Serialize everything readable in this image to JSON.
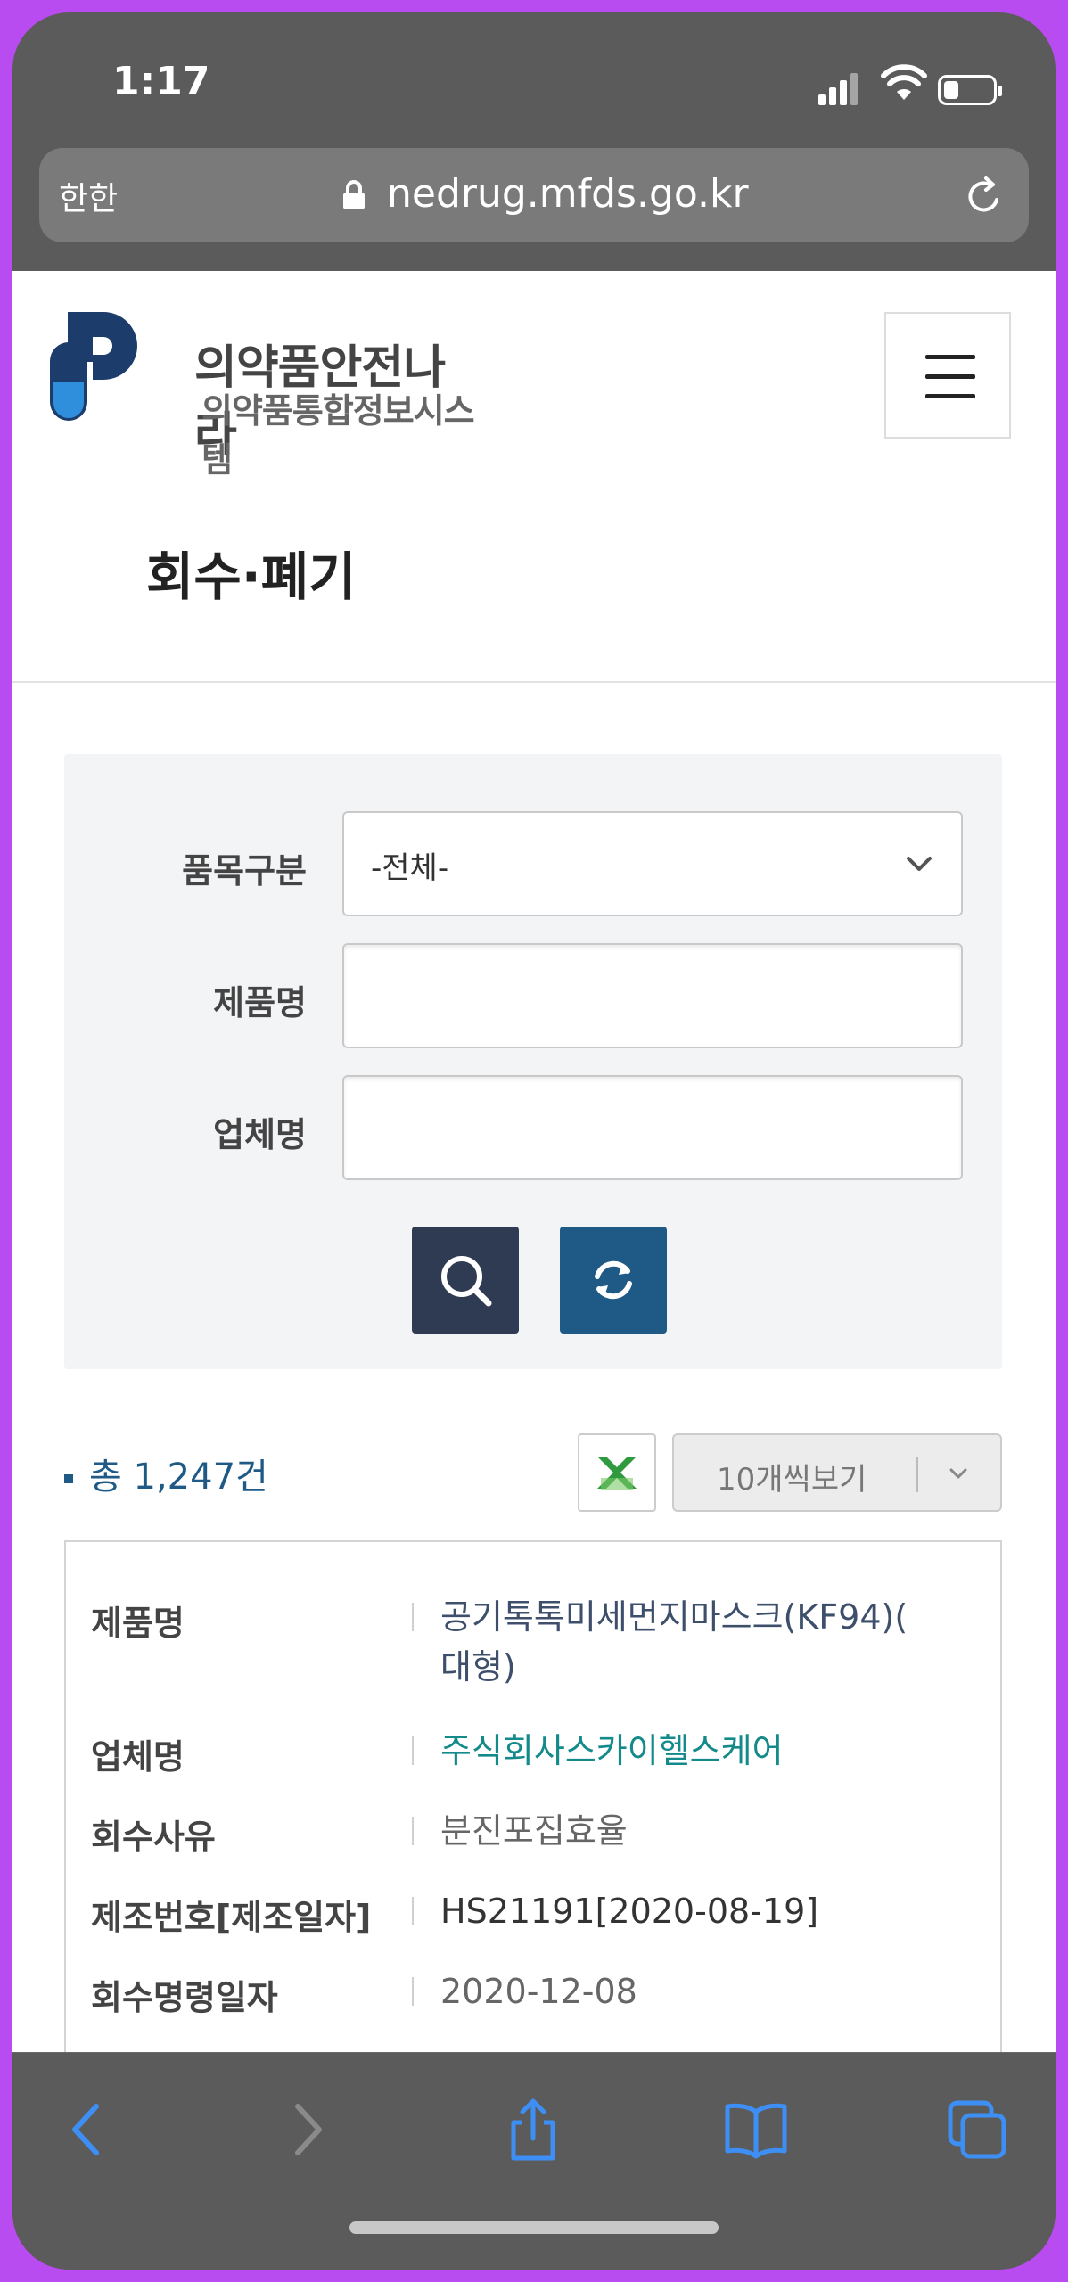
{
  "status_bar": {
    "time": "1:17"
  },
  "browser": {
    "aa_label": "한한",
    "url": "nedrug.mfds.go.kr"
  },
  "site": {
    "logo_title": "의약품안전나라",
    "logo_subtitle": "의약품통합정보시스템"
  },
  "page_title": "회수·폐기",
  "search": {
    "category_label": "품목구분",
    "category_value": "-전체-",
    "product_label": "제품명",
    "company_label": "업체명"
  },
  "results": {
    "total_text": "총 1,247건",
    "per_page": "10개씩보기"
  },
  "record": {
    "fields": [
      {
        "key": "제품명",
        "value": "공기톡톡미세먼지마스크(KF94)(\n대형)"
      },
      {
        "key": "업체명",
        "value": "주식회사스카이헬스케어"
      },
      {
        "key": "회수사유",
        "value": "분진포집효율"
      },
      {
        "key": "제조번호[제조일자]",
        "value": "HS21191[2020-08-19]"
      },
      {
        "key": "회수명령일자",
        "value": "2020-12-08"
      }
    ]
  },
  "colors": {
    "accent": "#1f5a86",
    "search_button": "#2e3b52",
    "company_link": "#148a8a",
    "ios_blue": "#3d8ff5"
  },
  "icons": [
    "lock-icon",
    "reload-icon",
    "hamburger-icon",
    "chevron-down-icon",
    "search-icon",
    "refresh-icon",
    "excel-icon",
    "back-icon",
    "forward-icon",
    "share-icon",
    "bookmarks-icon",
    "tabs-icon"
  ]
}
